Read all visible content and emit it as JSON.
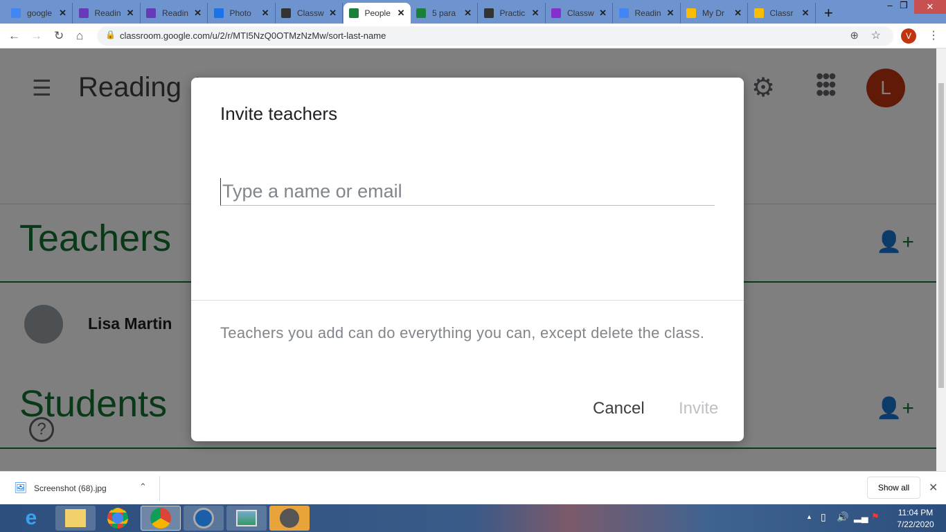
{
  "browser": {
    "tabs": [
      {
        "title": "google",
        "color": "#4285f4"
      },
      {
        "title": "Readin",
        "color": "#673ab7"
      },
      {
        "title": "Readin",
        "color": "#673ab7"
      },
      {
        "title": "Photo",
        "color": "#1a73e8"
      },
      {
        "title": "Classw",
        "color": "#333333"
      },
      {
        "title": "People",
        "color": "#188038",
        "active": true
      },
      {
        "title": "5 para",
        "color": "#188038"
      },
      {
        "title": "Practic",
        "color": "#333333"
      },
      {
        "title": "Classw",
        "color": "#8430ce"
      },
      {
        "title": "Readin",
        "color": "#4285f4"
      },
      {
        "title": "My Dr",
        "color": "#fbbc04"
      },
      {
        "title": "Classr",
        "color": "#fbbc04"
      }
    ],
    "url": "classroom.google.com/u/2/r/MTI5NzQ0OTMzNzMw/sort-last-name",
    "profile_initial": "V"
  },
  "page": {
    "class_title": "Reading 1",
    "avatar_initial": "L",
    "teachers_heading": "Teachers",
    "teacher_name": "Lisa Martin",
    "students_heading": "Students"
  },
  "dialog": {
    "title": "Invite teachers",
    "input_placeholder": "Type a name or email",
    "note": "Teachers you add can do everything you can, except delete the class.",
    "cancel": "Cancel",
    "invite": "Invite"
  },
  "downloads": {
    "file": "Screenshot (68).jpg",
    "show_all": "Show all"
  },
  "taskbar": {
    "time": "11:04 PM",
    "date": "7/22/2020"
  },
  "colors": {
    "accent_green": "#137333",
    "avatar": "#c1350e"
  }
}
